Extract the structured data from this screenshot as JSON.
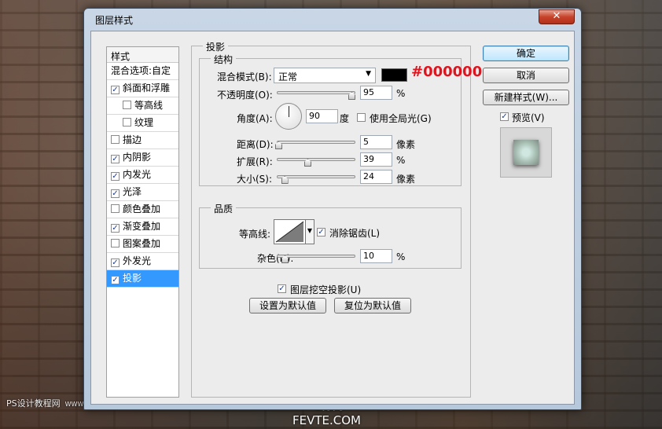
{
  "window": {
    "title": "图层样式",
    "close_glyph": "✕"
  },
  "styles": {
    "header": "样式",
    "blend_options": "混合选项:自定",
    "items": [
      {
        "label": "斜面和浮雕",
        "checked": true,
        "sub": false
      },
      {
        "label": "等高线",
        "checked": false,
        "sub": true
      },
      {
        "label": "纹理",
        "checked": false,
        "sub": true
      },
      {
        "label": "描边",
        "checked": false,
        "sub": false
      },
      {
        "label": "内阴影",
        "checked": true,
        "sub": false
      },
      {
        "label": "内发光",
        "checked": true,
        "sub": false
      },
      {
        "label": "光泽",
        "checked": true,
        "sub": false
      },
      {
        "label": "颜色叠加",
        "checked": false,
        "sub": false
      },
      {
        "label": "渐变叠加",
        "checked": true,
        "sub": false
      },
      {
        "label": "图案叠加",
        "checked": false,
        "sub": false
      },
      {
        "label": "外发光",
        "checked": true,
        "sub": false
      },
      {
        "label": "投影",
        "checked": true,
        "sub": false,
        "selected": true
      }
    ]
  },
  "drop_shadow": {
    "section_title": "投影",
    "structure": {
      "title": "结构",
      "blend_mode_label": "混合模式(B):",
      "blend_mode_value": "正常",
      "color": "#000000",
      "color_annotation": "#000000",
      "opacity_label": "不透明度(O):",
      "opacity_value": "95",
      "opacity_unit": "%",
      "angle_label": "角度(A):",
      "angle_value": "90",
      "angle_unit": "度",
      "global_light_label": "使用全局光(G)",
      "global_light_checked": false,
      "distance_label": "距离(D):",
      "distance_value": "5",
      "distance_unit": "像素",
      "spread_label": "扩展(R):",
      "spread_value": "39",
      "spread_unit": "%",
      "size_label": "大小(S):",
      "size_value": "24",
      "size_unit": "像素"
    },
    "quality": {
      "title": "品质",
      "contour_label": "等高线:",
      "antialias_label": "消除锯齿(L)",
      "antialias_checked": true,
      "noise_label": "杂色(N):",
      "noise_value": "10",
      "noise_unit": "%"
    },
    "knockout_label": "图层挖空投影(U)",
    "knockout_checked": true,
    "make_default": "设置为默认值",
    "reset_default": "复位为默认值"
  },
  "buttons": {
    "ok": "确定",
    "cancel": "取消",
    "new_style": "新建样式(W)...",
    "preview_label": "预览(V)",
    "preview_checked": true
  },
  "watermarks": {
    "left": "PS设计教程网",
    "left_small": "WWW.MISSYUAN.NET",
    "fevte_cn": "飞特网",
    "fevte_en": "FEVTE.COM"
  }
}
